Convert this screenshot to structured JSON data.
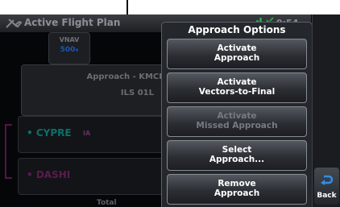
{
  "header": {
    "title": "Active Flight Plan",
    "clock": "9:54₄"
  },
  "vnav": {
    "label": "VNAV",
    "value": "500₄"
  },
  "approach": {
    "label": "Approach - KMCI",
    "procedure": "ILS 01L"
  },
  "waypoints": [
    {
      "name": "• CYPRE",
      "tag": "IA"
    },
    {
      "name": "• DASHI",
      "tag": ""
    }
  ],
  "footer": {
    "total_label": "Total"
  },
  "panel": {
    "title": "Approach Options",
    "options": [
      {
        "line1": "Activate",
        "line2": "Approach",
        "enabled": true
      },
      {
        "line1": "Activate",
        "line2": "Vectors-to-Final",
        "enabled": true
      },
      {
        "line1": "Activate",
        "line2": "Missed Approach",
        "enabled": false
      },
      {
        "line1": "Select",
        "line2": "Approach...",
        "enabled": true
      },
      {
        "line1": "Remove",
        "line2": "Approach",
        "enabled": true
      }
    ]
  },
  "back_button": {
    "label": "Back"
  },
  "icons": {
    "plane": "plane-icon",
    "signal": "signal-strength-icon",
    "gps": "gps-satellite-icon",
    "back": "back-arrow-icon"
  }
}
